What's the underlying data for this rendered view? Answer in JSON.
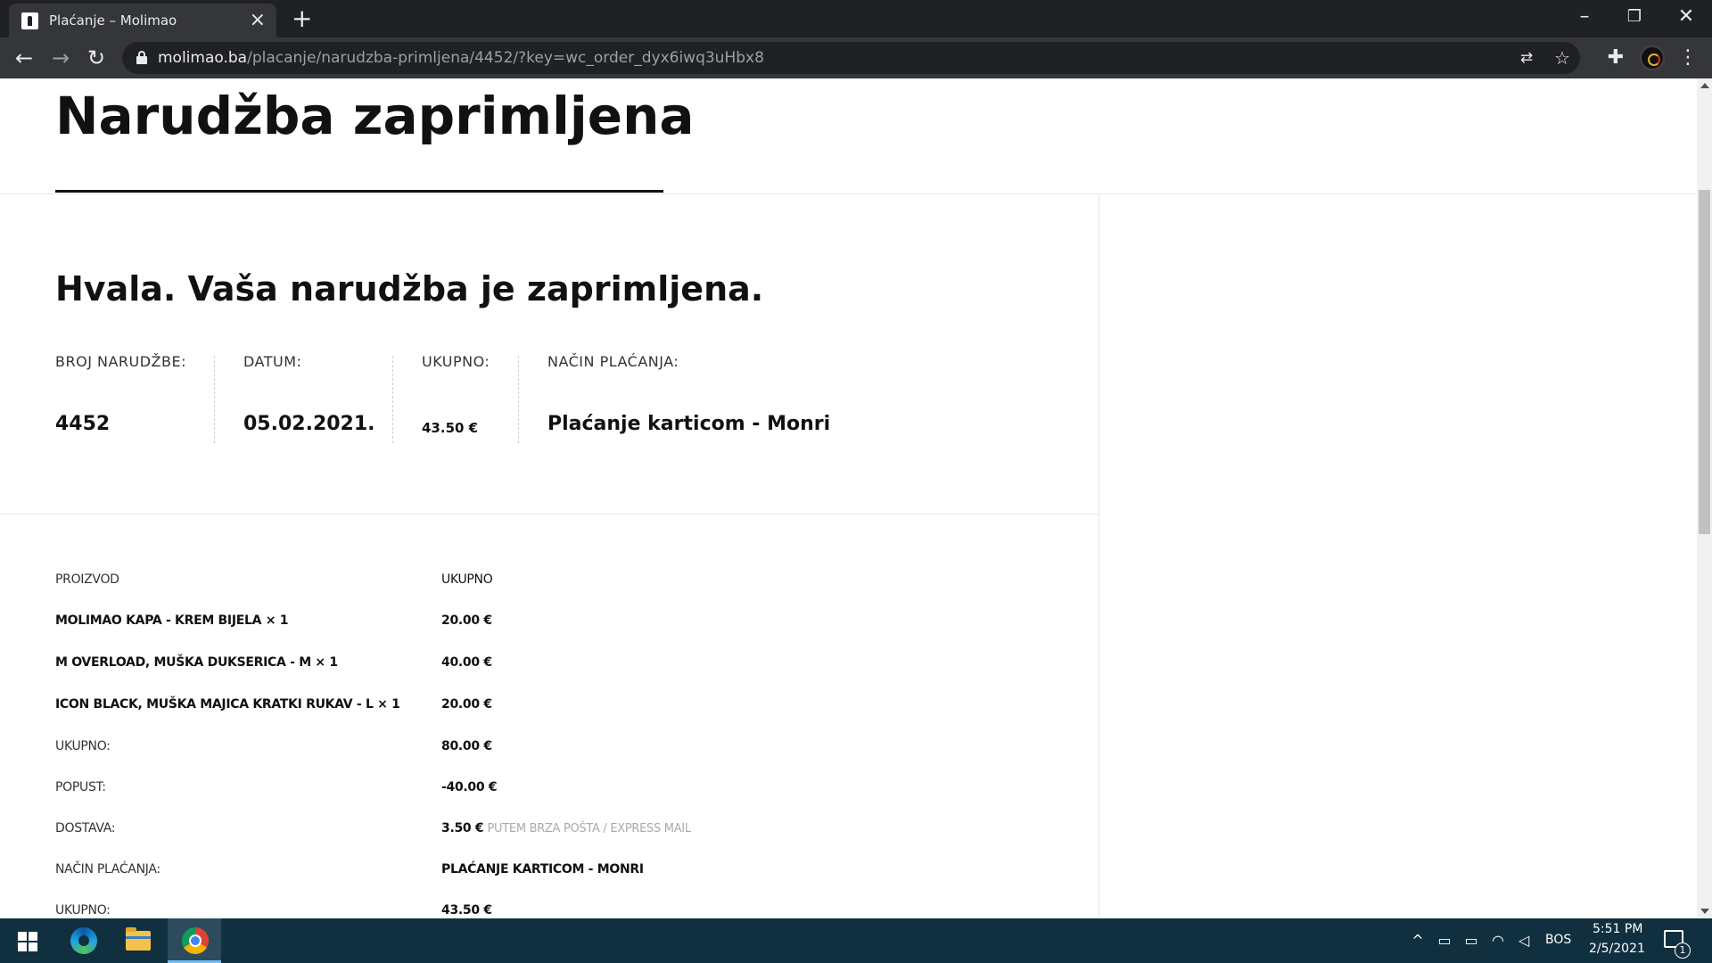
{
  "browser": {
    "tab_title": "Plaćanje – Molimao",
    "url_domain": "molimao.ba",
    "url_path": "/placanje/narudzba-primljena/4452/?key=wc_order_dyx6iwq3uHbx8"
  },
  "page": {
    "title": "Narudžba zaprimljena",
    "thanks": "Hvala. Vaša narudžba je zaprimljena."
  },
  "overview": {
    "order_number_label": "BROJ NARUDŽBE:",
    "order_number": "4452",
    "date_label": "DATUM:",
    "date": "05.02.2021.",
    "total_label": "UKUPNO:",
    "total": "43.50 €",
    "payment_label": "NAČIN PLAĆANJA:",
    "payment": "Plaćanje karticom - Monri"
  },
  "order_table": {
    "col_product": "PROIZVOD",
    "col_total": "UKUPNO",
    "items": [
      {
        "product": "MOLIMAO KAPA - KREM BIJELA × 1",
        "total": "20.00 €"
      },
      {
        "product": "M OVERLOAD, MUŠKA DUKSERICA - M × 1",
        "total": "40.00 €"
      },
      {
        "product": "ICON BLACK, MUŠKA MAJICA KRATKI RUKAV - L × 1",
        "total": "20.00 €"
      }
    ],
    "subtotal_label": "UKUPNO:",
    "subtotal": "80.00 €",
    "discount_label": "POPUST:",
    "discount": "-40.00 €",
    "shipping_label": "DOSTAVA:",
    "shipping": "3.50 €",
    "shipping_note": "PUTEM BRZA POŠTA / EXPRESS MAIL",
    "payment_label": "NAČIN PLAĆANJA:",
    "payment": "PLAĆANJE KARTICOM - MONRI",
    "total_label": "UKUPNO:",
    "total": "43.50 €"
  },
  "taskbar": {
    "language": "BOS",
    "time": "5:51 PM",
    "date": "2/5/2021",
    "notification_count": "1"
  }
}
